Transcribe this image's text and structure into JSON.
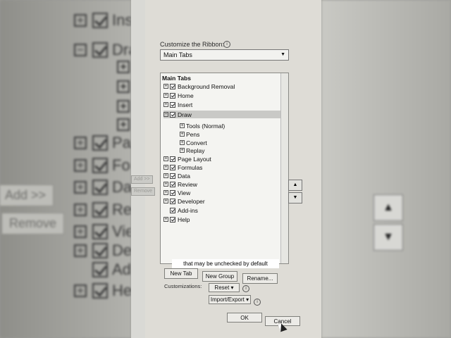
{
  "background": {
    "left_items": [
      {
        "label": "Ins",
        "expander": "+"
      },
      {
        "label": "Draw",
        "expander": "−"
      },
      {
        "label": "Pag",
        "expander": "+"
      },
      {
        "label": "For",
        "expander": "+"
      },
      {
        "label": "Dat",
        "expander": "+"
      },
      {
        "label": "Rev",
        "expander": "+"
      },
      {
        "label": "Vie",
        "expander": "+"
      },
      {
        "label": "Dev",
        "expander": "+"
      },
      {
        "label": "Ad",
        "expander": ""
      },
      {
        "label": "He",
        "expander": "+"
      }
    ],
    "add_label": "Add >>",
    "remove_label": "Remove"
  },
  "dialog": {
    "customize_label": "Customize the Ribbon:",
    "tabs_select": {
      "value": "Main Tabs"
    },
    "tree_header": "Main Tabs",
    "tree_items": [
      {
        "label": "Background Removal",
        "expander": "+",
        "checked": true,
        "level": 0
      },
      {
        "label": "Home",
        "expander": "+",
        "checked": true,
        "level": 0
      },
      {
        "label": "Insert",
        "expander": "+",
        "checked": true,
        "level": 0
      },
      {
        "label": "Draw",
        "expander": "−",
        "checked": true,
        "level": 0,
        "selected": true
      },
      {
        "label": "Tools (Normal)",
        "expander": "+",
        "checked": false,
        "level": 1
      },
      {
        "label": "Pens",
        "expander": "+",
        "checked": false,
        "level": 1
      },
      {
        "label": "Convert",
        "expander": "+",
        "checked": false,
        "level": 1
      },
      {
        "label": "Replay",
        "expander": "+",
        "checked": false,
        "level": 1
      },
      {
        "label": "Page Layout",
        "expander": "+",
        "checked": true,
        "level": 0
      },
      {
        "label": "Formulas",
        "expander": "+",
        "checked": true,
        "level": 0
      },
      {
        "label": "Data",
        "expander": "+",
        "checked": true,
        "level": 0
      },
      {
        "label": "Review",
        "expander": "+",
        "checked": true,
        "level": 0
      },
      {
        "label": "View",
        "expander": "+",
        "checked": true,
        "level": 0
      },
      {
        "label": "Developer",
        "expander": "+",
        "checked": true,
        "level": 0
      },
      {
        "label": "Add-ins",
        "expander": "",
        "checked": true,
        "level": 0
      },
      {
        "label": "Help",
        "expander": "+",
        "checked": true,
        "level": 0
      }
    ],
    "add_label": "Add >>",
    "remove_label": "Remove",
    "new_tab_label": "New Tab",
    "new_group_label": "New Group",
    "rename_label": "Rename...",
    "customizations_label": "Customizations:",
    "reset_label": "Reset ▾",
    "import_export_label": "Import/Export ▾",
    "ok_label": "OK",
    "cancel_label": "Cancel"
  },
  "caption": "that may be unchecked by default"
}
